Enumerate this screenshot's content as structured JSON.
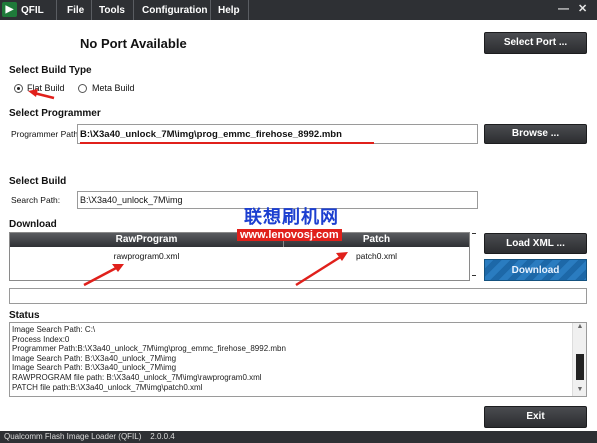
{
  "app": {
    "title": "QFIL",
    "logo_glyph": "▶"
  },
  "menu": [
    "File",
    "Tools",
    "Configuration",
    "Help"
  ],
  "window_controls": {
    "minimize": "—",
    "close": "✕"
  },
  "port": {
    "status": "No Port Available",
    "select_button": "Select Port ..."
  },
  "build_type": {
    "heading": "Select Build Type",
    "options": [
      {
        "label": "Flat Build",
        "selected": true
      },
      {
        "label": "Meta Build",
        "selected": false
      }
    ]
  },
  "programmer": {
    "heading": "Select Programmer",
    "path_label": "Programmer Path",
    "path_value": "B:\\X3a40_unlock_7M\\img\\prog_emmc_firehose_8992.mbn",
    "browse_button": "Browse ..."
  },
  "build": {
    "heading": "Select Build",
    "search_label": "Search Path:",
    "search_value": "B:\\X3a40_unlock_7M\\img"
  },
  "download": {
    "heading": "Download",
    "columns": [
      "RawProgram",
      "Patch"
    ],
    "rows": [
      {
        "rawprogram": "rawprogram0.xml",
        "patch": "patch0.xml"
      }
    ],
    "load_xml_button": "Load XML ...",
    "download_button": "Download"
  },
  "status": {
    "heading": "Status",
    "lines": [
      "Image Search Path: C:\\",
      "Process Index:0",
      "Programmer Path:B:\\X3a40_unlock_7M\\img\\prog_emmc_firehose_8992.mbn",
      "Image Search Path: B:\\X3a40_unlock_7M\\img",
      "Image Search Path: B:\\X3a40_unlock_7M\\img",
      "RAWPROGRAM file path: B:\\X3a40_unlock_7M\\img\\rawprogram0.xml",
      "PATCH file path:B:\\X3a40_unlock_7M\\img\\patch0.xml"
    ]
  },
  "exit_button": "Exit",
  "footer": "Qualcomm Flash Image Loader (QFIL)    2.0.0.4",
  "watermark": {
    "chinese": "联想刷机网",
    "url": "www.lenovosj.com"
  },
  "colors": {
    "titlebar": "#2e3034",
    "accent_blue": "#1f6fb0",
    "annotation_red": "#e0201b",
    "watermark": "#1c3fd0"
  }
}
